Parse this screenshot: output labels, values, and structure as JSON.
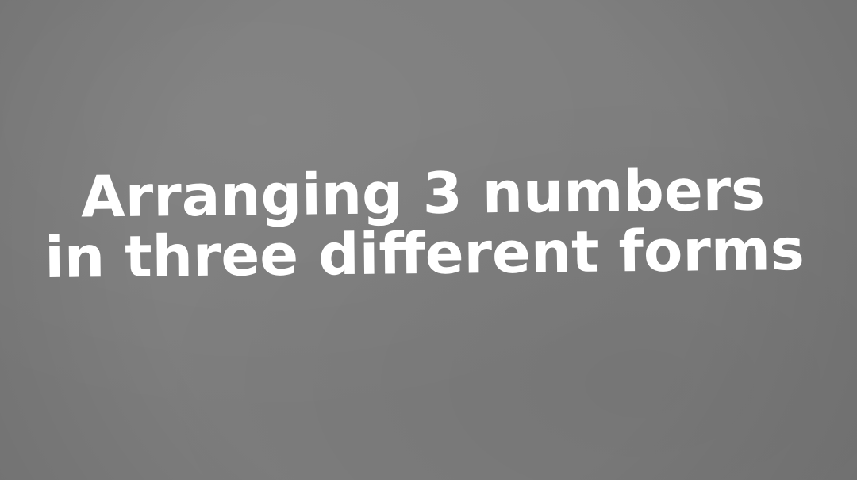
{
  "title": {
    "line1": "Arranging 3 numbers",
    "line2": "in three different forms"
  },
  "colors": {
    "background": "#7d7d7d",
    "text": "#ffffff"
  }
}
